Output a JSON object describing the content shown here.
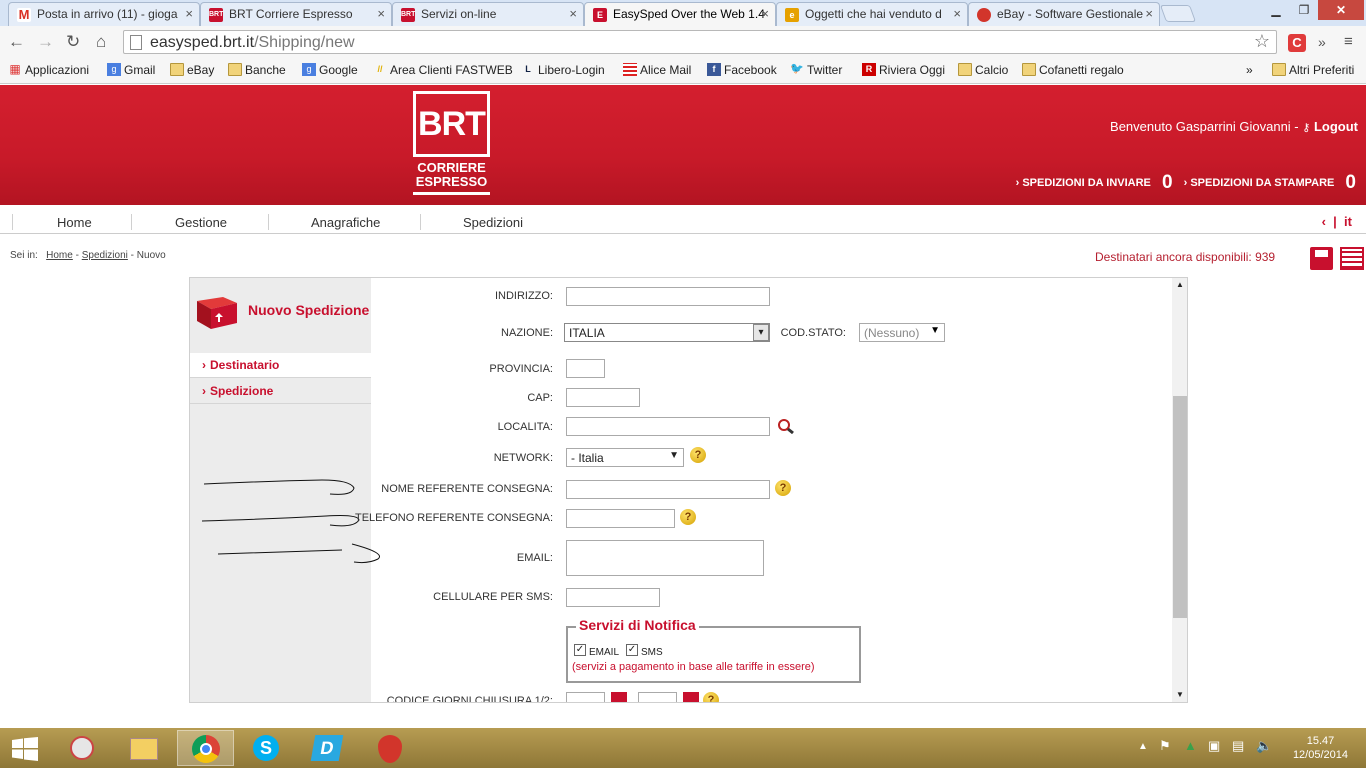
{
  "browser": {
    "tabs": [
      {
        "title": "Posta in arrivo (11) - gioga",
        "icon": "gmail-icon",
        "color": "#d93025",
        "glyph": "M"
      },
      {
        "title": "BRT Corriere Espresso",
        "icon": "brt-icon",
        "color": "#c8102e",
        "glyph": "BRT"
      },
      {
        "title": "Servizi on-line",
        "icon": "brt-icon",
        "color": "#c8102e",
        "glyph": "BRT"
      },
      {
        "title": "EasySped Over the Web 1.4",
        "icon": "easysped-icon",
        "color": "#c8102e",
        "glyph": "E"
      },
      {
        "title": "Oggetti che hai venduto d",
        "icon": "ebay-icon",
        "color": "#e6a100",
        "glyph": "e"
      },
      {
        "title": "eBay - Software Gestionale",
        "icon": "strawberry-icon",
        "color": "#d2352b",
        "glyph": "●"
      }
    ],
    "url_host": "easysped.brt.it",
    "url_path": "/Shipping/new",
    "bookmarks": [
      {
        "label": "Applicazioni"
      },
      {
        "label": "Gmail"
      },
      {
        "label": "eBay"
      },
      {
        "label": "Banche"
      },
      {
        "label": "Google"
      },
      {
        "label": "Area Clienti FASTWEB"
      },
      {
        "label": "Libero-Login"
      },
      {
        "label": "Alice Mail"
      },
      {
        "label": "Facebook"
      },
      {
        "label": "Twitter"
      },
      {
        "label": "Riviera Oggi"
      },
      {
        "label": "Calcio"
      },
      {
        "label": "Cofanetti regalo"
      }
    ],
    "more_bookmarks": "»",
    "other_bookmarks": "Altri Preferiti"
  },
  "header": {
    "logo_main": "BRT",
    "logo_line1": "CORRIERE",
    "logo_line2": "ESPRESSO",
    "welcome": "Benvenuto Gasparrini Giovanni -",
    "logout": "Logout",
    "to_send_label": "SPEDIZIONI DA INVIARE",
    "to_send_count": "0",
    "to_print_label": "SPEDIZIONI DA STAMPARE",
    "to_print_count": "0"
  },
  "menu": {
    "items": [
      "Home",
      "Gestione",
      "Anagrafiche",
      "Spedizioni"
    ],
    "lang": "it"
  },
  "breadcrumb": {
    "prefix": "Sei in:",
    "home": "Home",
    "sep1": "-",
    "section": "Spedizioni",
    "sep2": "-",
    "current": "Nuovo"
  },
  "available": "Destinatari ancora disponibili: 939",
  "side": {
    "title": "Nuovo Spedizione",
    "links": [
      "Destinatario",
      "Spedizione"
    ]
  },
  "form": {
    "indirizzo_label": "INDIRIZZO:",
    "indirizzo_value": "",
    "nazione_label": "NAZIONE:",
    "nazione_value": "ITALIA",
    "codstato_label": "COD.STATO:",
    "codstato_value": "(Nessuno)",
    "provincia_label": "PROVINCIA:",
    "cap_label": "CAP:",
    "localita_label": "LOCALITA:",
    "network_label": "NETWORK:",
    "network_value": "- Italia",
    "nome_ref_label": "NOME REFERENTE CONSEGNA:",
    "tel_ref_label": "TELEFONO REFERENTE CONSEGNA:",
    "email_label": "EMAIL:",
    "cell_label": "CELLULARE PER SMS:",
    "codice_label": "CODICE GIORNI CHIUSURA 1/2:",
    "notifica_title": "Servizi di Notifica",
    "notifica_email": "EMAIL",
    "notifica_email_checked": true,
    "notifica_sms": "SMS",
    "notifica_sms_checked": true,
    "notifica_note": "(servizi a pagamento in base alle tariffe in essere)",
    "help_glyph": "?"
  },
  "taskbar": {
    "time": "15.47",
    "date": "12/05/2014"
  }
}
